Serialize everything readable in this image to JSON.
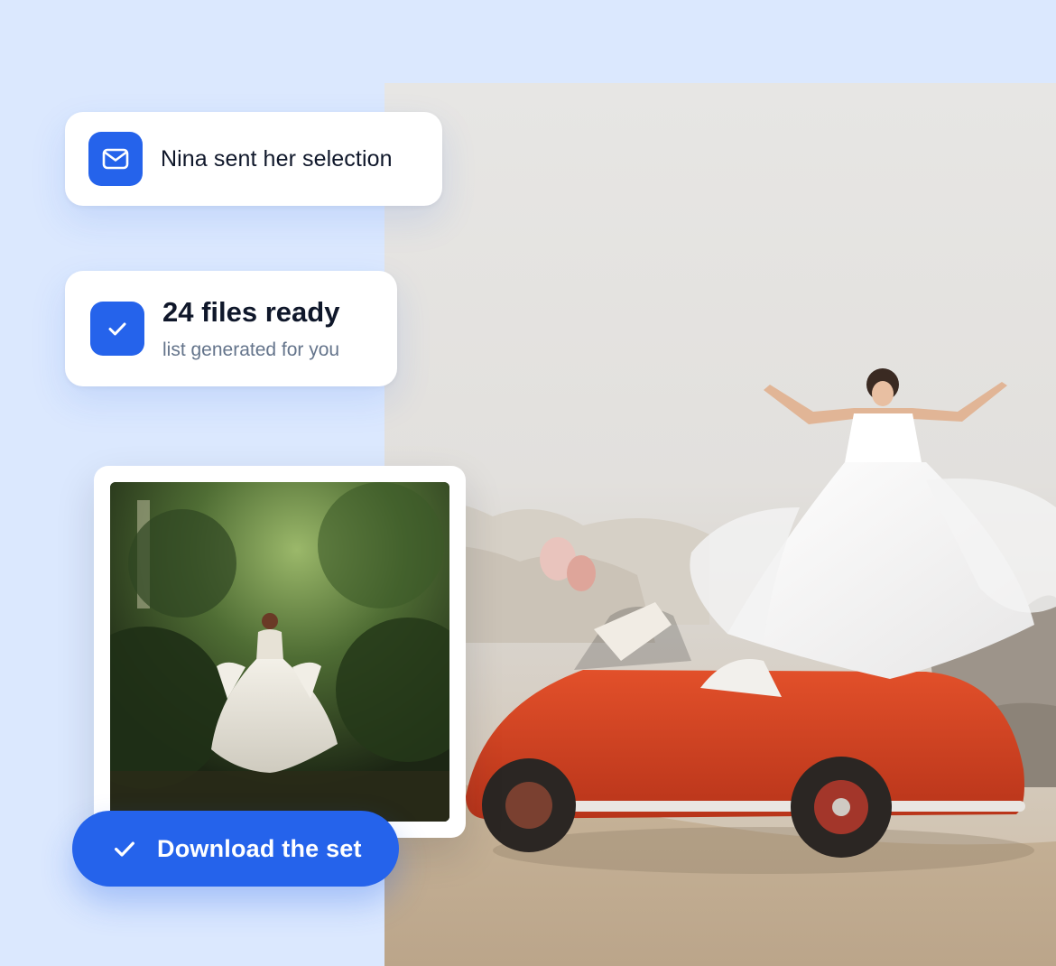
{
  "theme": {
    "background": "#dbe8fe",
    "accent": "#2563eb",
    "card_background": "#ffffff",
    "title_color": "#0f172a",
    "subtitle_color": "#64748b"
  },
  "hero_photo": {
    "icon": "wedding-photo"
  },
  "notifications": [
    {
      "icon": "mail-icon",
      "title": "Nina sent her selection"
    },
    {
      "icon": "check-icon",
      "title": "24 files ready",
      "subtitle": "list generated for you"
    }
  ],
  "thumbnail": {
    "icon": "forest-bride-photo"
  },
  "download": {
    "icon": "check-icon",
    "label": "Download the set"
  }
}
